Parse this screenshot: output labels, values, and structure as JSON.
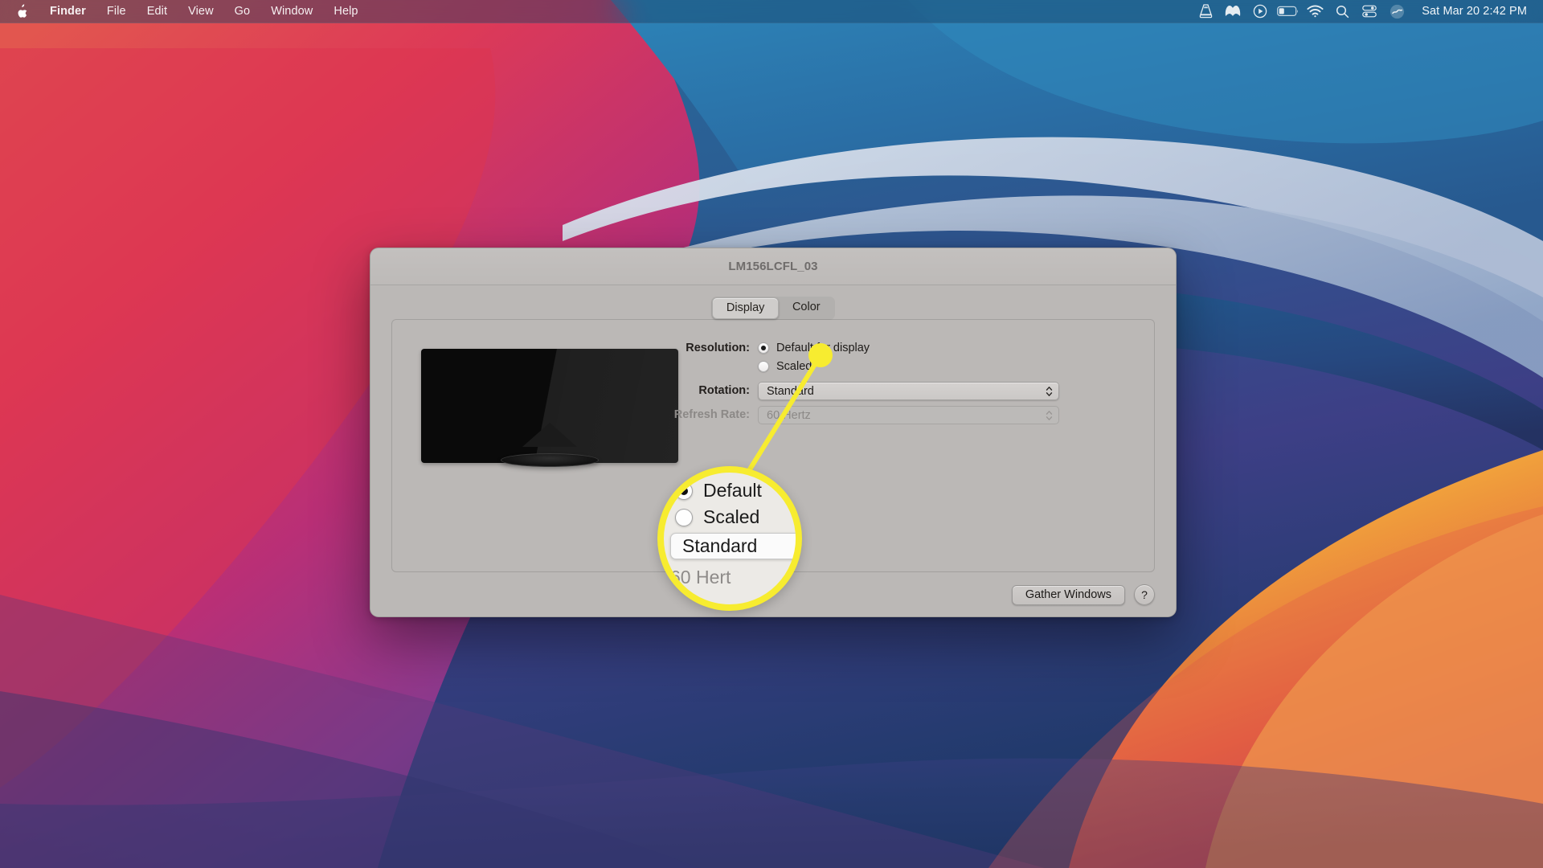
{
  "menubar": {
    "apple_icon": "apple-logo-icon",
    "items": [
      {
        "label": "Finder",
        "bold": true
      },
      {
        "label": "File",
        "bold": false
      },
      {
        "label": "Edit",
        "bold": false
      },
      {
        "label": "View",
        "bold": false
      },
      {
        "label": "Go",
        "bold": false
      },
      {
        "label": "Window",
        "bold": false
      },
      {
        "label": "Help",
        "bold": false
      }
    ],
    "status_icons": [
      "vlc-cone-icon",
      "malwarebytes-m-icon",
      "play-circle-icon",
      "battery-icon",
      "wifi-icon",
      "search-spotlight-icon",
      "control-center-icon",
      "siri-icon"
    ],
    "clock": "Sat Mar 20  2:42 PM"
  },
  "window": {
    "title": "LM156LCFL_03",
    "tabs": [
      {
        "label": "Display",
        "active": true
      },
      {
        "label": "Color",
        "active": false
      }
    ],
    "preview_alt": "external-display-preview",
    "form": {
      "resolution": {
        "label": "Resolution:",
        "options": [
          {
            "label": "Default for display",
            "selected": true
          },
          {
            "label": "Scaled",
            "selected": false
          }
        ]
      },
      "rotation": {
        "label": "Rotation:",
        "value": "Standard",
        "disabled": false
      },
      "refresh_rate": {
        "label": "Refresh Rate:",
        "value": "60 Hertz",
        "disabled": true
      }
    },
    "footer": {
      "gather_windows_label": "Gather Windows",
      "help_label": "?"
    }
  },
  "callout": {
    "accent_color": "#f7ec30",
    "magnified": {
      "radio_default_label": "Default",
      "radio_scaled_label": "Scaled",
      "popup_value": "Standard",
      "dim_value": "60 Hert"
    }
  },
  "colors": {
    "window_bg": "#bbb8b6",
    "titlebar_bg": "#c3c0be",
    "menubar_tint": "#1d3f66",
    "accent_yellow": "#f7ec30",
    "wallpaper_red": "#d8364a",
    "wallpaper_blue": "#2a76ad",
    "wallpaper_orange": "#f0a03c",
    "wallpaper_purple": "#7a3c86"
  }
}
